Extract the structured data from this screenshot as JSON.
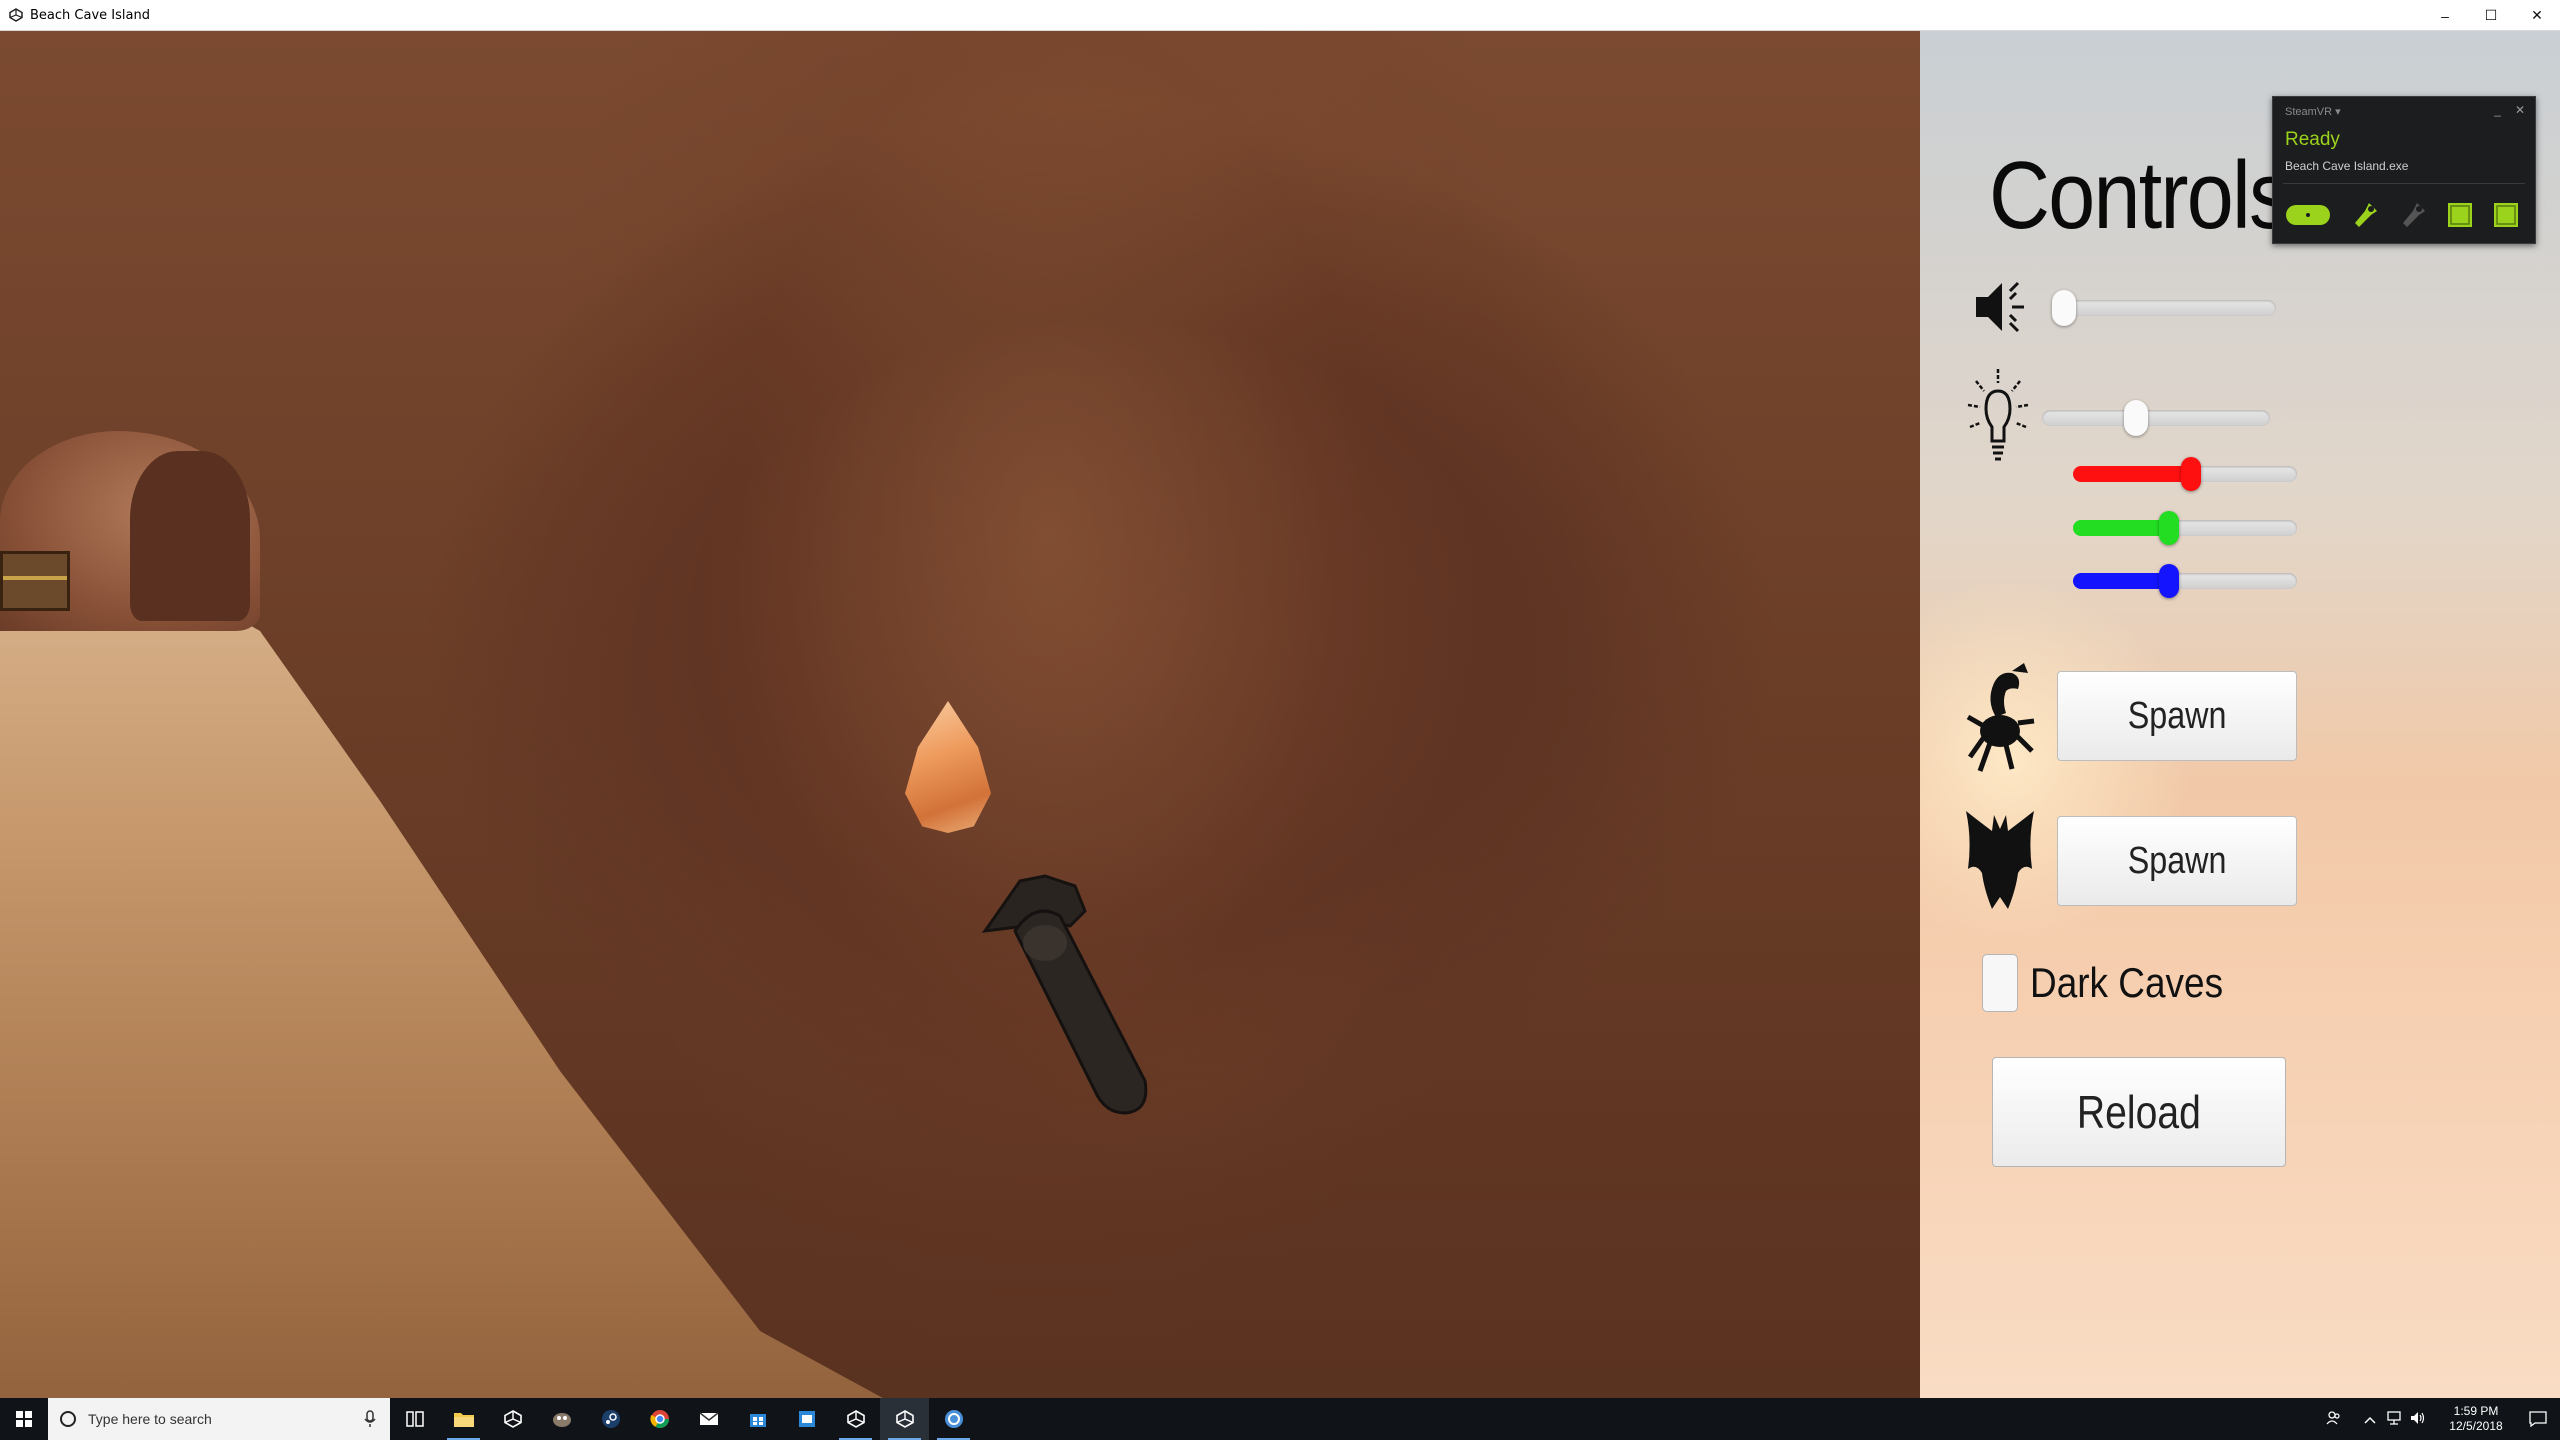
{
  "window": {
    "title": "Beach Cave Island",
    "minimize": "–",
    "maximize": "☐",
    "close": "✕"
  },
  "panel": {
    "title": "Controls",
    "sliders": {
      "volume": 0.0,
      "brightness": 0.4,
      "red": 0.53,
      "green": 0.42,
      "blue": 0.42
    },
    "crab_spawn_label": "Spawn",
    "bat_spawn_label": "Spawn",
    "dark_caves_label": "Dark Caves",
    "dark_caves_checked": false,
    "reload_label": "Reload"
  },
  "steamvr": {
    "header": "SteamVR ▾",
    "minimize": "_",
    "close": "✕",
    "status": "Ready",
    "app": "Beach Cave Island.exe",
    "accent": "#9bd21c"
  },
  "taskbar": {
    "search_placeholder": "Type here to search",
    "time": "1:59 PM",
    "date": "12/5/2018"
  }
}
